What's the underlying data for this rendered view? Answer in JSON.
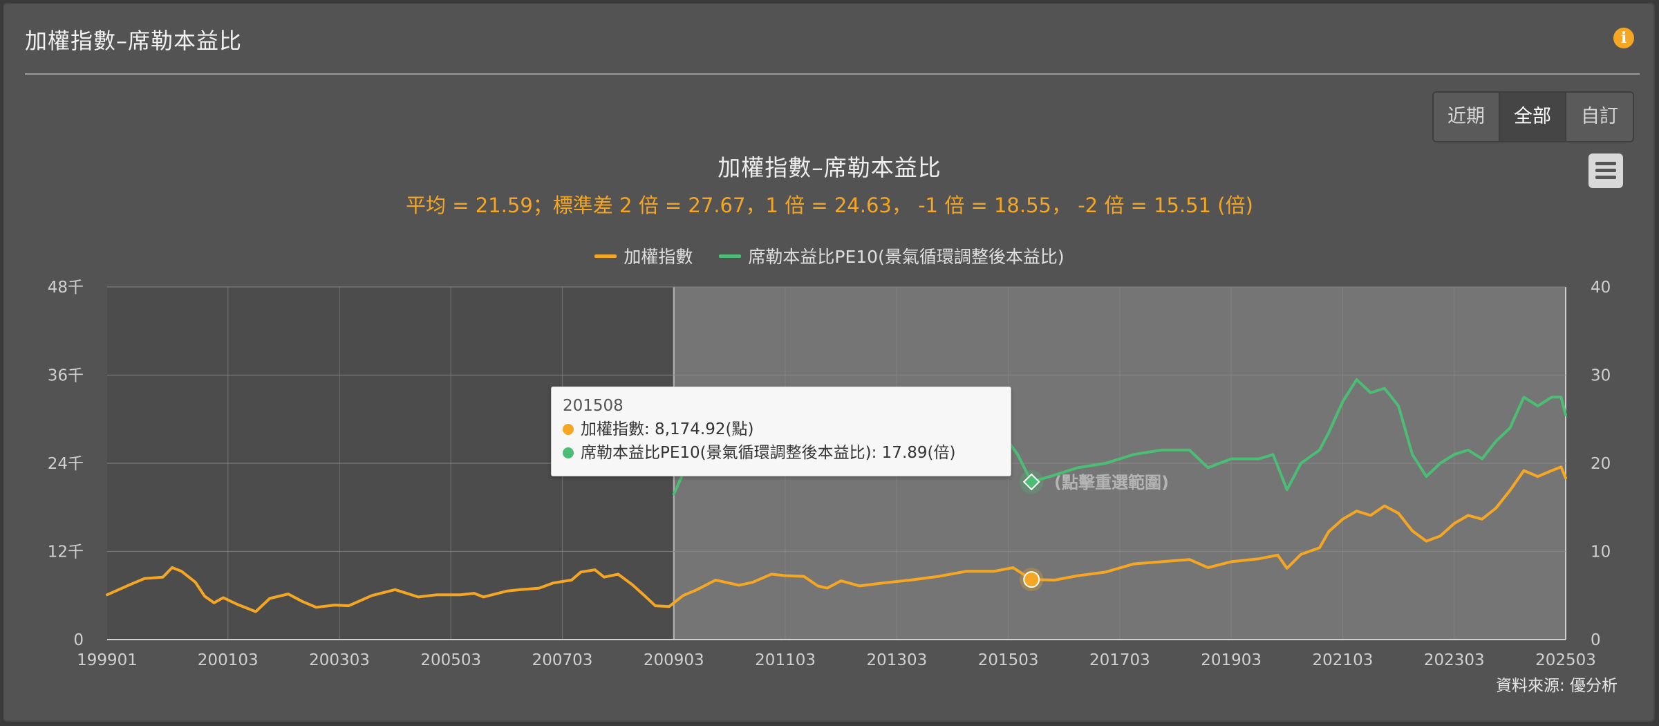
{
  "panel": {
    "title": "加權指數–席勒本益比",
    "info_icon": "info-icon",
    "accent": "#f5a623"
  },
  "range_buttons": [
    {
      "label": "近期",
      "active": false
    },
    {
      "label": "全部",
      "active": true
    },
    {
      "label": "自訂",
      "active": false
    }
  ],
  "menu_icon": "hamburger-menu-icon",
  "tooltip": {
    "date": "201508",
    "rows": [
      {
        "label": "加權指數: 8,174.92(點)",
        "color": "#f5a623"
      },
      {
        "label": "席勒本益比PE10(景氣循環調整後本益比): 17.89(倍)",
        "color": "#4cbd74"
      }
    ]
  },
  "reset_label": "(點擊重選範圍)",
  "source": "資料來源: 優分析",
  "chart_data": {
    "type": "line",
    "title": "加權指數–席勒本益比",
    "subtitle": "平均 = 21.59；標準差 2 倍 = 27.67，1 倍 = 24.63， -1 倍 = 18.55， -2 倍 = 15.51 (倍)",
    "x_tick_labels": [
      "199901",
      "200103",
      "200303",
      "200503",
      "200703",
      "200903",
      "201103",
      "201303",
      "201503",
      "201703",
      "201903",
      "202103",
      "202303",
      "202503"
    ],
    "x_range": [
      "1999-01",
      "2025-03"
    ],
    "y_left": {
      "range": [
        0,
        48000
      ],
      "ticks": [
        "0",
        "12千",
        "24千",
        "36千",
        "48千"
      ]
    },
    "y_right": {
      "range": [
        0,
        40
      ],
      "ticks": [
        "0",
        "10",
        "20",
        "30",
        "40"
      ]
    },
    "grid": true,
    "legend_position": "top-center",
    "selected_range": [
      "2009-03",
      "2025-03"
    ],
    "series": [
      {
        "name": "加權指數",
        "color": "#f5a623",
        "axis": "left",
        "points": [
          [
            "1999-01",
            6100
          ],
          [
            "1999-06",
            7500
          ],
          [
            "1999-09",
            8300
          ],
          [
            "2000-01",
            8500
          ],
          [
            "2000-03",
            9800
          ],
          [
            "2000-05",
            9300
          ],
          [
            "2000-08",
            7800
          ],
          [
            "2000-10",
            5900
          ],
          [
            "2000-12",
            5000
          ],
          [
            "2001-02",
            5700
          ],
          [
            "2001-05",
            4800
          ],
          [
            "2001-09",
            3800
          ],
          [
            "2001-12",
            5600
          ],
          [
            "2002-04",
            6200
          ],
          [
            "2002-07",
            5200
          ],
          [
            "2002-10",
            4400
          ],
          [
            "2003-02",
            4700
          ],
          [
            "2003-05",
            4600
          ],
          [
            "2003-10",
            6000
          ],
          [
            "2004-03",
            6800
          ],
          [
            "2004-08",
            5800
          ],
          [
            "2004-12",
            6100
          ],
          [
            "2005-05",
            6100
          ],
          [
            "2005-08",
            6300
          ],
          [
            "2005-10",
            5800
          ],
          [
            "2006-03",
            6600
          ],
          [
            "2006-06",
            6800
          ],
          [
            "2006-10",
            7000
          ],
          [
            "2007-01",
            7700
          ],
          [
            "2007-05",
            8100
          ],
          [
            "2007-07",
            9200
          ],
          [
            "2007-10",
            9500
          ],
          [
            "2007-12",
            8500
          ],
          [
            "2008-03",
            8900
          ],
          [
            "2008-06",
            7500
          ],
          [
            "2008-09",
            5800
          ],
          [
            "2008-11",
            4600
          ],
          [
            "2009-02",
            4500
          ],
          [
            "2009-05",
            6000
          ],
          [
            "2009-08",
            6800
          ],
          [
            "2009-12",
            8100
          ],
          [
            "2010-05",
            7400
          ],
          [
            "2010-08",
            7800
          ],
          [
            "2010-12",
            8900
          ],
          [
            "2011-03",
            8700
          ],
          [
            "2011-07",
            8600
          ],
          [
            "2011-10",
            7300
          ],
          [
            "2011-12",
            7000
          ],
          [
            "2012-03",
            8000
          ],
          [
            "2012-07",
            7300
          ],
          [
            "2012-12",
            7700
          ],
          [
            "2013-06",
            8100
          ],
          [
            "2013-12",
            8600
          ],
          [
            "2014-06",
            9300
          ],
          [
            "2014-12",
            9300
          ],
          [
            "2015-04",
            9800
          ],
          [
            "2015-08",
            8174.92
          ],
          [
            "2016-01",
            8100
          ],
          [
            "2016-06",
            8700
          ],
          [
            "2016-12",
            9200
          ],
          [
            "2017-06",
            10300
          ],
          [
            "2017-12",
            10600
          ],
          [
            "2018-06",
            10900
          ],
          [
            "2018-10",
            9800
          ],
          [
            "2019-03",
            10600
          ],
          [
            "2019-09",
            11000
          ],
          [
            "2020-01",
            11500
          ],
          [
            "2020-03",
            9700
          ],
          [
            "2020-06",
            11600
          ],
          [
            "2020-10",
            12500
          ],
          [
            "2020-12",
            14700
          ],
          [
            "2021-03",
            16400
          ],
          [
            "2021-06",
            17500
          ],
          [
            "2021-09",
            16900
          ],
          [
            "2021-12",
            18200
          ],
          [
            "2022-03",
            17200
          ],
          [
            "2022-06",
            14800
          ],
          [
            "2022-09",
            13400
          ],
          [
            "2022-12",
            14100
          ],
          [
            "2023-03",
            15800
          ],
          [
            "2023-06",
            16900
          ],
          [
            "2023-09",
            16400
          ],
          [
            "2023-12",
            17900
          ],
          [
            "2024-03",
            20300
          ],
          [
            "2024-06",
            23000
          ],
          [
            "2024-09",
            22200
          ],
          [
            "2024-12",
            23000
          ],
          [
            "2025-02",
            23500
          ],
          [
            "2025-03",
            22000
          ]
        ]
      },
      {
        "name": "席勒本益比PE10(景氣循環調整後本益比)",
        "color": "#4cbd74",
        "axis": "right",
        "points": [
          [
            "2009-03",
            16.5
          ],
          [
            "2009-06",
            20
          ],
          [
            "2009-10",
            22
          ],
          [
            "2010-02",
            22.5
          ],
          [
            "2010-06",
            21
          ],
          [
            "2010-10",
            24
          ],
          [
            "2010-12",
            25.5
          ],
          [
            "2011-03",
            25.5
          ],
          [
            "2011-06",
            25
          ],
          [
            "2011-09",
            23
          ],
          [
            "2011-12",
            21
          ],
          [
            "2012-04",
            22
          ],
          [
            "2012-07",
            19.5
          ],
          [
            "2012-12",
            21
          ],
          [
            "2013-06",
            21
          ],
          [
            "2013-12",
            21
          ],
          [
            "2014-06",
            22
          ],
          [
            "2014-12",
            21.5
          ],
          [
            "2015-03",
            22.5
          ],
          [
            "2015-05",
            21
          ],
          [
            "2015-08",
            17.89
          ],
          [
            "2015-12",
            18.5
          ],
          [
            "2016-06",
            19.5
          ],
          [
            "2016-12",
            20
          ],
          [
            "2017-06",
            21
          ],
          [
            "2017-12",
            21.5
          ],
          [
            "2018-06",
            21.5
          ],
          [
            "2018-10",
            19.5
          ],
          [
            "2019-03",
            20.5
          ],
          [
            "2019-09",
            20.5
          ],
          [
            "2019-12",
            21
          ],
          [
            "2020-03",
            17
          ],
          [
            "2020-06",
            20
          ],
          [
            "2020-10",
            21.5
          ],
          [
            "2020-12",
            23.5
          ],
          [
            "2021-03",
            27
          ],
          [
            "2021-06",
            29.5
          ],
          [
            "2021-09",
            28
          ],
          [
            "2021-12",
            28.5
          ],
          [
            "2022-03",
            26.5
          ],
          [
            "2022-06",
            21
          ],
          [
            "2022-09",
            18.5
          ],
          [
            "2022-12",
            20
          ],
          [
            "2023-03",
            21
          ],
          [
            "2023-06",
            21.5
          ],
          [
            "2023-09",
            20.5
          ],
          [
            "2023-12",
            22.5
          ],
          [
            "2024-03",
            24
          ],
          [
            "2024-06",
            27.5
          ],
          [
            "2024-09",
            26.5
          ],
          [
            "2024-12",
            27.5
          ],
          [
            "2025-02",
            27.5
          ],
          [
            "2025-03",
            25.5
          ]
        ]
      }
    ],
    "highlight": {
      "date": "2015-08",
      "index_value": 8174.92,
      "pe_value": 17.89
    }
  }
}
